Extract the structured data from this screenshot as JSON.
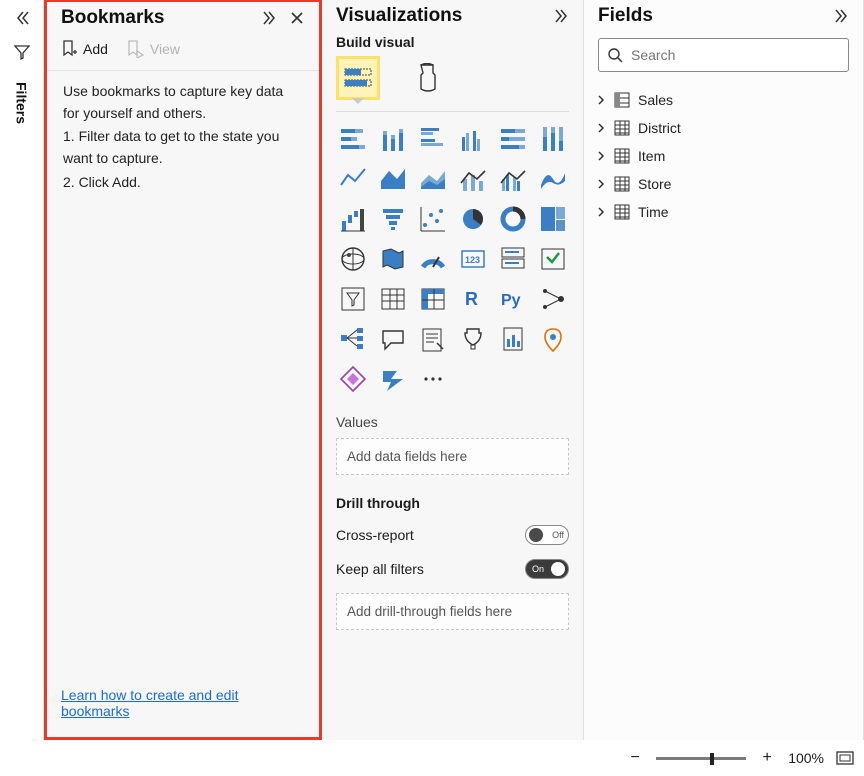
{
  "filters_label": "Filters",
  "bookmarks": {
    "title": "Bookmarks",
    "add_label": "Add",
    "view_label": "View",
    "help_intro": "Use bookmarks to capture key data for yourself and others.",
    "help_step1": "1. Filter data to get to the state you want to capture.",
    "help_step2": "2. Click Add.",
    "learn_link": "Learn how to create and edit bookmarks"
  },
  "viz": {
    "title": "Visualizations",
    "build_label": "Build visual",
    "values_label": "Values",
    "values_placeholder": "Add data fields here",
    "drill_header": "Drill through",
    "cross_report_label": "Cross-report",
    "cross_report_state": "Off",
    "keep_filters_label": "Keep all filters",
    "keep_filters_state": "On",
    "drill_placeholder": "Add drill-through fields here",
    "items": [
      "stacked-bar",
      "stacked-column",
      "clustered-bar",
      "clustered-column",
      "100-stacked-bar",
      "100-stacked-column",
      "line",
      "area",
      "stacked-area",
      "line-stacked-column",
      "line-clustered-column",
      "ribbon",
      "waterfall",
      "funnel",
      "scatter",
      "pie",
      "donut",
      "treemap",
      "map",
      "filled-map",
      "gauge",
      "card",
      "multirow-card",
      "kpi",
      "slicer",
      "table",
      "matrix",
      "r-visual",
      "py-visual",
      "key-influencers",
      "decomposition-tree",
      "qa",
      "narrative",
      "goals",
      "paginated",
      "arcgis",
      "powerapps",
      "powerautomate",
      "more"
    ]
  },
  "fields": {
    "title": "Fields",
    "search_placeholder": "Search",
    "items": [
      {
        "name": "Sales",
        "icon": "hierarchy"
      },
      {
        "name": "District",
        "icon": "table"
      },
      {
        "name": "Item",
        "icon": "table"
      },
      {
        "name": "Store",
        "icon": "table"
      },
      {
        "name": "Time",
        "icon": "table"
      }
    ]
  },
  "status": {
    "zoom_label": "100%"
  }
}
